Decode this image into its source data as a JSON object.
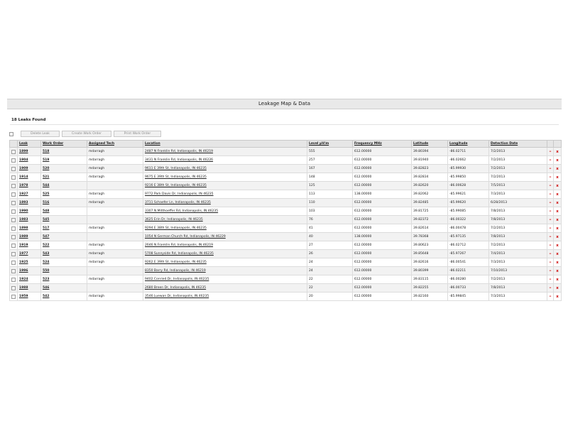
{
  "panel": {
    "title": "Leakage Map & Data"
  },
  "summary": {
    "count_text": "18 Leaks Found"
  },
  "toolbar": {
    "delete_label": "Delete Leak",
    "create_label": "Create Work Order",
    "print_label": "Print Work Order"
  },
  "columns": [
    "Leak",
    "Work Order",
    "Assigned Tech",
    "Location",
    "Level µV/m",
    "Frequency MHz",
    "Latitude",
    "Longitude",
    "Detection Date"
  ],
  "row_actions": {
    "edit_symbol": "–",
    "delete_symbol": "x"
  },
  "rows": [
    {
      "leak": "1899",
      "work_order": "518",
      "tech": "mdarragh",
      "location": "2487 N Franklin Rd, Indianapolis, IN 46219",
      "level": "555",
      "freq": "612.00000",
      "lat": "39.80394",
      "lon": "-86.02711",
      "date": "7/2/2013"
    },
    {
      "leak": "1904",
      "work_order": "519",
      "tech": "mdarragh",
      "location": "3431 N Franklin Rd, Indianapolis, IN 46226",
      "level": "257",
      "freq": "612.00000",
      "lat": "39.81940",
      "lon": "-86.02662",
      "date": "7/2/2013"
    },
    {
      "leak": "1909",
      "work_order": "520",
      "tech": "mdarragh",
      "location": "9611 E 39th St, Indianapolis, IN 46235",
      "level": "167",
      "freq": "612.00000",
      "lat": "39.82823",
      "lon": "-85.99930",
      "date": "7/2/2013"
    },
    {
      "leak": "1914",
      "work_order": "521",
      "tech": "mdarragh",
      "location": "9675 E 39th St, Indianapolis, IN 46235",
      "level": "148",
      "freq": "612.00000",
      "lat": "39.82834",
      "lon": "-85.99850",
      "date": "7/2/2013"
    },
    {
      "leak": "1978",
      "work_order": "544",
      "tech": "",
      "location": "9216 E 38th St, Indianapolis, IN 46235",
      "level": "125",
      "freq": "612.00000",
      "lat": "39.82620",
      "lon": "-86.00628",
      "date": "7/5/2013"
    },
    {
      "leak": "1927",
      "work_order": "525",
      "tech": "mdarragh",
      "location": "9772 Park Davis Dr, Indianapolis, IN 46235",
      "level": "113",
      "freq": "138.00000",
      "lat": "39.82062",
      "lon": "-85.99621",
      "date": "7/3/2013"
    },
    {
      "leak": "1893",
      "work_order": "516",
      "tech": "mdarragh",
      "location": "3711 Schaefer Ln, Indianapolis, IN 46235",
      "level": "110",
      "freq": "612.00000",
      "lat": "39.82485",
      "lon": "-85.99620",
      "date": "6/28/2013"
    },
    {
      "leak": "1990",
      "work_order": "548",
      "tech": "",
      "location": "3307 N Mitthoeffer Rd, Indianapolis, IN 46235",
      "level": "103",
      "freq": "612.00000",
      "lat": "39.81725",
      "lon": "-85.99085",
      "date": "7/8/2013"
    },
    {
      "leak": "1983",
      "work_order": "545",
      "tech": "",
      "location": "3625 Erin Dr, Indianapolis, IN 46235",
      "level": "76",
      "freq": "612.00000",
      "lat": "39.82372",
      "lon": "-86.00322",
      "date": "7/8/2013"
    },
    {
      "leak": "1898",
      "work_order": "517",
      "tech": "mdarragh",
      "location": "9294 E 38th St, Indianapolis, IN 46235",
      "level": "41",
      "freq": "612.00000",
      "lat": "39.82614",
      "lon": "-86.00478",
      "date": "7/2/2013"
    },
    {
      "leak": "1989",
      "work_order": "547",
      "tech": "",
      "location": "1054 N German Church Rd, Indianapolis, IN 46229",
      "level": "40",
      "freq": "138.00000",
      "lat": "39.78368",
      "lon": "-85.97135",
      "date": "7/8/2013"
    },
    {
      "leak": "1919",
      "work_order": "522",
      "tech": "mdarragh",
      "location": "2646 N Franklin Rd, Indianapolis, IN 46219",
      "level": "27",
      "freq": "612.00000",
      "lat": "39.80623",
      "lon": "-86.02712",
      "date": "7/2/2013"
    },
    {
      "leak": "1977",
      "work_order": "543",
      "tech": "mdarragh",
      "location": "5708 Sunnyside Rd, Indianapolis, IN 46235",
      "level": "26",
      "freq": "612.00000",
      "lat": "39.85648",
      "lon": "-85.97267",
      "date": "7/4/2013"
    },
    {
      "leak": "1925",
      "work_order": "524",
      "tech": "mdarragh",
      "location": "9262 E 39th St, Indianapolis, IN 46235",
      "level": "24",
      "freq": "612.00000",
      "lat": "39.82616",
      "lon": "-86.00541",
      "date": "7/3/2013"
    },
    {
      "leak": "1996",
      "work_order": "550",
      "tech": "",
      "location": "8350 Barry Rd, Indianapolis, IN 46219",
      "level": "24",
      "freq": "612.00000",
      "lat": "39.80399",
      "lon": "-86.02211",
      "date": "7/10/2013"
    },
    {
      "leak": "1924",
      "work_order": "523",
      "tech": "mdarragh",
      "location": "9402 Conried Dr, Indianapolis, IN 46235",
      "level": "22",
      "freq": "612.00000",
      "lat": "39.83115",
      "lon": "-86.00280",
      "date": "7/2/2013"
    },
    {
      "leak": "1988",
      "work_order": "546",
      "tech": "",
      "location": "2680 Breen Dr, Indianapolis, IN 46235",
      "level": "22",
      "freq": "612.00000",
      "lat": "39.82255",
      "lon": "-86.00733",
      "date": "7/8/2013"
    },
    {
      "leak": "1959",
      "work_order": "542",
      "tech": "mdarragh",
      "location": "3546 Luewan Dr, Indianapolis, IN 46235",
      "level": "20",
      "freq": "612.00000",
      "lat": "39.82160",
      "lon": "-85.99845",
      "date": "7/3/2013"
    }
  ]
}
